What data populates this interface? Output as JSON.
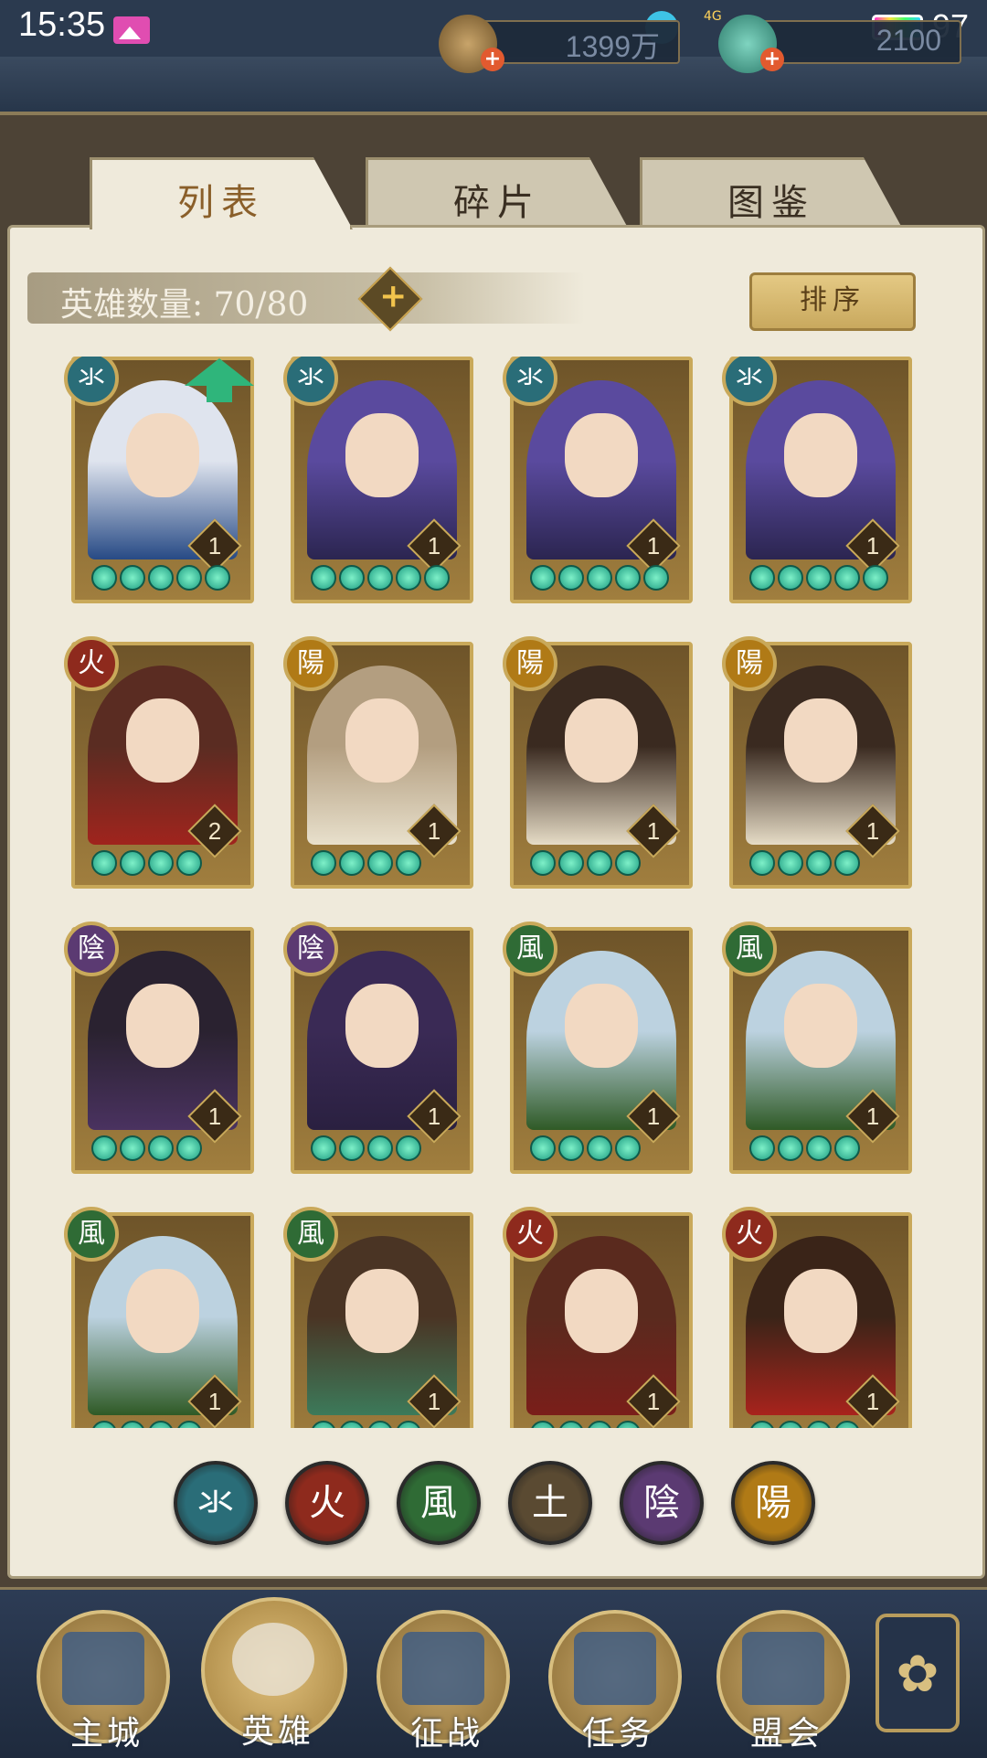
{
  "status_bar": {
    "time": "15:35",
    "network": "4G",
    "battery": "97"
  },
  "resources": {
    "coins": "1399万",
    "jade": "2100"
  },
  "tabs": [
    {
      "label": "列表",
      "active": true
    },
    {
      "label": "碎片",
      "active": false
    },
    {
      "label": "图鉴",
      "active": false
    }
  ],
  "hero_count": {
    "label": "英雄数量: 70/80"
  },
  "sort_button": "排序",
  "elements": {
    "water": {
      "glyph": "氺",
      "color": "#2a6d78"
    },
    "fire": {
      "glyph": "火",
      "color": "#8e2a1d"
    },
    "wind": {
      "glyph": "風",
      "color": "#2f6b35"
    },
    "earth": {
      "glyph": "土",
      "color": "#5a4a32"
    },
    "yin": {
      "glyph": "陰",
      "color": "#5b3a72"
    },
    "yang": {
      "glyph": "陽",
      "color": "#b07a16"
    }
  },
  "heroes": [
    {
      "element": "water",
      "level": "1",
      "stars": 5,
      "colors": [
        "#dfe4ee",
        "#274a85"
      ],
      "upgrade": true
    },
    {
      "element": "water",
      "level": "1",
      "stars": 5,
      "colors": [
        "#5a4a9e",
        "#2b2550"
      ]
    },
    {
      "element": "water",
      "level": "1",
      "stars": 5,
      "colors": [
        "#5a4a9e",
        "#2b2550"
      ]
    },
    {
      "element": "water",
      "level": "1",
      "stars": 5,
      "colors": [
        "#5a4a9e",
        "#2b2550"
      ]
    },
    {
      "element": "fire",
      "level": "2",
      "stars": 4,
      "colors": [
        "#5a2c22",
        "#a0241d"
      ]
    },
    {
      "element": "yang",
      "level": "1",
      "stars": 4,
      "colors": [
        "#b39e80",
        "#e8e0cc"
      ]
    },
    {
      "element": "yang",
      "level": "1",
      "stars": 4,
      "colors": [
        "#3a2a20",
        "#e6dcc6"
      ]
    },
    {
      "element": "yang",
      "level": "1",
      "stars": 4,
      "colors": [
        "#3a2a20",
        "#e6dcc6"
      ]
    },
    {
      "element": "yin",
      "level": "1",
      "stars": 4,
      "colors": [
        "#2a2230",
        "#4a3260"
      ]
    },
    {
      "element": "yin",
      "level": "1",
      "stars": 4,
      "colors": [
        "#3a2a55",
        "#2a2040"
      ]
    },
    {
      "element": "wind",
      "level": "1",
      "stars": 4,
      "colors": [
        "#bcd2e0",
        "#2f5a26"
      ]
    },
    {
      "element": "wind",
      "level": "1",
      "stars": 4,
      "colors": [
        "#bcd2e0",
        "#2f5a26"
      ]
    },
    {
      "element": "wind",
      "level": "1",
      "stars": 4,
      "colors": [
        "#bcd2e0",
        "#2f5a26"
      ]
    },
    {
      "element": "wind",
      "level": "1",
      "stars": 4,
      "colors": [
        "#4a3424",
        "#3c7a5a"
      ]
    },
    {
      "element": "fire",
      "level": "1",
      "stars": 4,
      "colors": [
        "#5a2a1e",
        "#7a1e1a"
      ]
    },
    {
      "element": "fire",
      "level": "1",
      "stars": 4,
      "colors": [
        "#3a2418",
        "#a8231c"
      ]
    }
  ],
  "filters": [
    "water",
    "fire",
    "wind",
    "earth",
    "yin",
    "yang"
  ],
  "bottom_nav": [
    {
      "label": "主城",
      "active": false
    },
    {
      "label": "英雄",
      "active": true
    },
    {
      "label": "征战",
      "active": false
    },
    {
      "label": "任务",
      "active": false
    },
    {
      "label": "盟会",
      "active": false
    }
  ]
}
